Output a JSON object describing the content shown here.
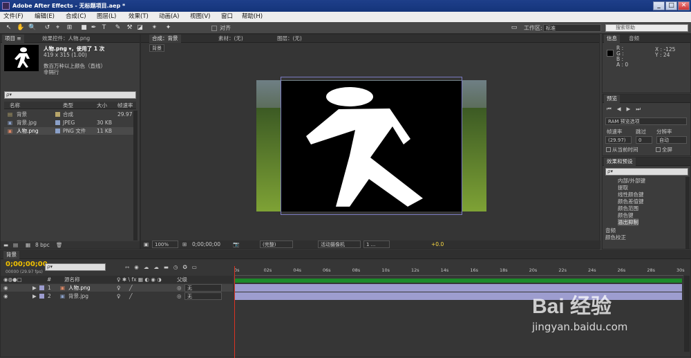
{
  "window": {
    "title": "Adobe After Effects - 无标题项目.aep *",
    "min": "_",
    "max": "□",
    "close": "✕"
  },
  "menu": [
    "文件(F)",
    "编辑(E)",
    "合成(C)",
    "图层(L)",
    "效果(T)",
    "动画(A)",
    "视图(V)",
    "窗口",
    "帮助(H)"
  ],
  "toolbar": {
    "snap_label": "对齐",
    "workspace_label": "工作区:",
    "workspace_value": "标准",
    "search_placeholder": "搜索帮助"
  },
  "project": {
    "tab_project": "项目 ≡",
    "tab_effect": "效果控件：人物.png",
    "selected_name": "人物.png ▾，使用了 1 次",
    "selected_size": "419 x 315 (1.00)",
    "selected_color": "数百万种以上颜色（直线）",
    "selected_interlace": "非隔行",
    "search_placeholder": "ρ▾",
    "headers": {
      "name": "名称",
      "type": "类型",
      "size": "大小",
      "fps": "帧速率"
    },
    "items": [
      {
        "name": "背景",
        "type": "合成",
        "size": "",
        "fps": "29.97",
        "color": "#b8a66a"
      },
      {
        "name": "背景.jpg",
        "type": "JPEG",
        "size": "30 KB",
        "fps": "",
        "color": "#8aa0c8"
      },
      {
        "name": "人物.png",
        "type": "PNG 文件",
        "size": "11 KB",
        "fps": "",
        "color": "#8aa0c8"
      }
    ],
    "bpc": "8 bpc"
  },
  "comp": {
    "tab_comp": "合成：背景",
    "tab_footage": "素材：(无)",
    "tab_layer": "图层：(无)",
    "breadcrumb": "背景",
    "zoom": "100%",
    "timecode": "0;00;00;00",
    "quality": "(完整)",
    "camera": "活动摄像机",
    "views": "1 ...",
    "exposure": "+0.0"
  },
  "info": {
    "tab_info": "信息",
    "tab_audio": "音频",
    "r": "R :",
    "g": "G :",
    "b": "B :",
    "a": "A : 0",
    "x": "X : -125",
    "y": "Y : 24"
  },
  "preview": {
    "tab": "预览",
    "ram_label": "RAM 预览选项",
    "fps_label": "帧速率",
    "skip_label": "跳过",
    "res_label": "分辨率",
    "fps_value": "(29.97)",
    "skip_value": "0",
    "res_value": "自动",
    "from_current": "从当前时间",
    "fullscreen": "全屏"
  },
  "effects": {
    "tab": "效果和预设",
    "search_placeholder": "ρ▾",
    "items": [
      "内部/外部键",
      "提取",
      "线性颜色键",
      "颜色差值键",
      "颜色范围",
      "颜色键",
      "溢出抑制"
    ],
    "categories": [
      "音频",
      "颜色校正"
    ]
  },
  "timeline": {
    "tab": "背景",
    "timecode": "0;00;00;00",
    "frame_info": "00000 (29.97 fps)",
    "search_placeholder": "ρ▾",
    "col_num": "#",
    "col_name": "源名称",
    "col_switches": "♀ ✱ \\ fx ▦ ◐ ◉ ◑",
    "col_parent": "父级",
    "ruler": [
      "0s",
      "02s",
      "04s",
      "06s",
      "08s",
      "10s",
      "12s",
      "14s",
      "16s",
      "18s",
      "20s",
      "22s",
      "24s",
      "26s",
      "28s",
      "30s"
    ],
    "layers": [
      {
        "num": "1",
        "name": "人物.png",
        "parent": "无",
        "color": "#9d9dcf"
      },
      {
        "num": "2",
        "name": "背景.jpg",
        "parent": "无",
        "color": "#9d9dcf"
      }
    ],
    "playhead_fraction": 0.0
  },
  "watermark": {
    "brand": "Bai 经验",
    "url": "jingyan.baidu.com"
  }
}
